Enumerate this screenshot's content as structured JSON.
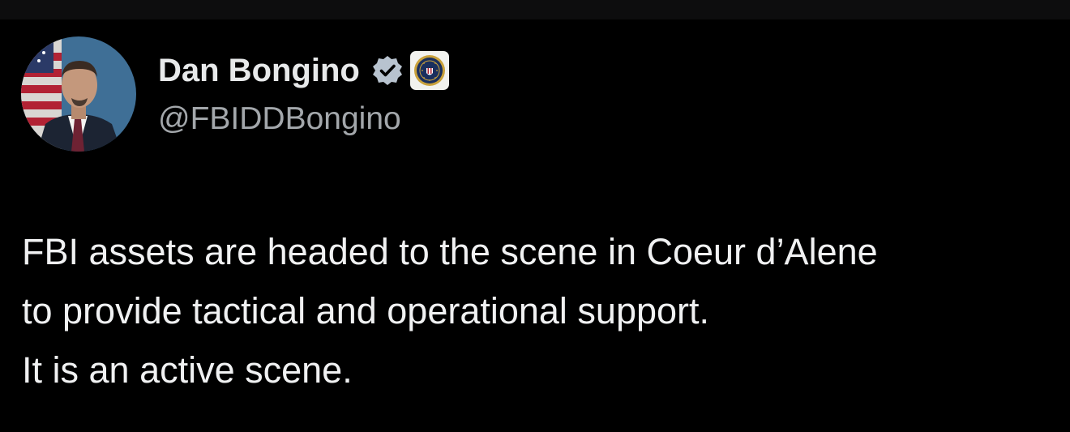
{
  "author": {
    "display_name": "Dan Bongino",
    "handle": "@FBIDDBongino",
    "verified_icon": "verified-badge-icon",
    "affiliate_badge": "fbi-seal-icon"
  },
  "tweet": {
    "lines": [
      "FBI assets are headed to the scene in Coeur d’Alene",
      "to provide tactical and operational support.",
      "It is an active scene."
    ]
  },
  "colors": {
    "background": "#000000",
    "text_primary": "#e7e9ea",
    "text_secondary": "#a3a7ab",
    "verified": "#b8c3cf"
  }
}
